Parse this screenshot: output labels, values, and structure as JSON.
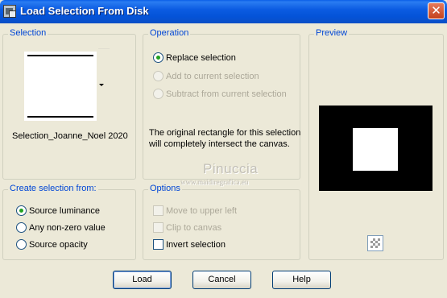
{
  "window": {
    "title": "Load Selection From Disk",
    "close_glyph": "✕"
  },
  "selection": {
    "group_title": "Selection",
    "selected_name": "Selection_Joanne_Noel 2020"
  },
  "operation": {
    "group_title": "Operation",
    "options": [
      {
        "label": "Replace selection",
        "checked": true,
        "enabled": true
      },
      {
        "label": "Add to current selection",
        "checked": false,
        "enabled": false
      },
      {
        "label": "Subtract from current selection",
        "checked": false,
        "enabled": false
      }
    ],
    "description_line1": "The original rectangle for this selection",
    "description_line2": "will completely intersect the canvas."
  },
  "preview": {
    "group_title": "Preview"
  },
  "create_from": {
    "group_title": "Create selection from:",
    "options": [
      {
        "label": "Source luminance",
        "checked": true
      },
      {
        "label": "Any non-zero value",
        "checked": false
      },
      {
        "label": "Source opacity",
        "checked": false
      }
    ]
  },
  "options": {
    "group_title": "Options",
    "items": [
      {
        "label": "Move to upper left",
        "checked": false,
        "enabled": false
      },
      {
        "label": "Clip to canvas",
        "checked": false,
        "enabled": false
      },
      {
        "label": "Invert selection",
        "checked": false,
        "enabled": true
      }
    ]
  },
  "watermark": {
    "name": "Pinuccia",
    "url": "www.maidiregrafica.eu"
  },
  "buttons": {
    "load": "Load",
    "cancel": "Cancel",
    "help": "Help"
  },
  "icons": {
    "app": "selection-app-icon",
    "close": "close-icon",
    "dropdown": "chevron-down-icon",
    "checker": "transparency-checker-icon"
  },
  "colors": {
    "group_title": "#0046d5",
    "title_bar": "#0453d8",
    "radio_dot": "#21a121"
  }
}
